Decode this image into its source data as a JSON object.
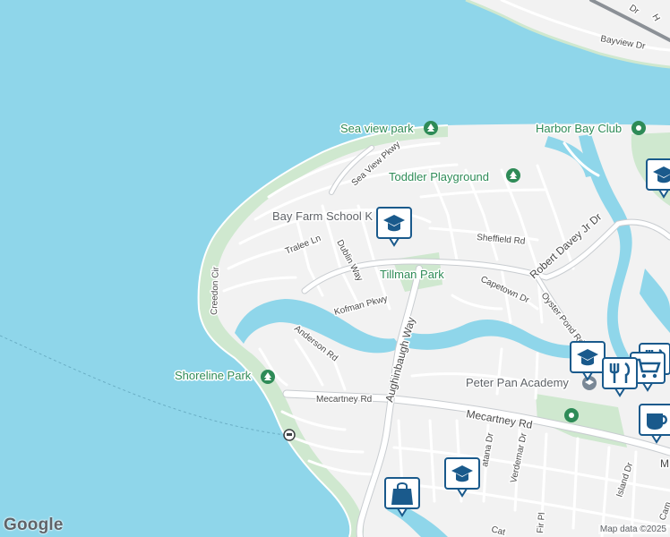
{
  "map": {
    "colors": {
      "water": "#8fd6ea",
      "land": "#f2f2f2",
      "park": "#cfe8cf",
      "road": "#ffffff",
      "road_outline": "#c8ccd0",
      "poi_green": "#2e8b57",
      "pin_blue": "#1a5a8c"
    },
    "parks": [
      {
        "name": "Sea view park",
        "icon": "tree-icon"
      },
      {
        "name": "Harbor Bay Club",
        "icon": "location-pin-icon"
      },
      {
        "name": "Toddler Playground",
        "icon": "tree-icon"
      },
      {
        "name": "Tillman Park",
        "icon": ""
      },
      {
        "name": "Shoreline Park",
        "icon": "tree-icon"
      },
      {
        "name": "Peter Pan Academy",
        "icon": "location-pin-icon"
      }
    ],
    "labels": {
      "bay_farm_school": "Bay Farm School K",
      "bayview_dr": "Bayview Dr",
      "top_dr": "Dr",
      "top_h": "H"
    },
    "streets": [
      "Sea View Pkwy",
      "Tralee Ln",
      "Dublin Way",
      "Creedon Cir",
      "Kofman Pkwy",
      "Anderson Rd",
      "Aughinbaugh Way",
      "Sheffield Rd",
      "Robert Davey Jr Dr",
      "Capetown Dr",
      "Oyster Pond Rd",
      "Mecartney Rd",
      "Mecartney Rd",
      "Verdemar Dr",
      "Island Dr",
      "atana Dr",
      "Fir Pl",
      "Cat"
    ],
    "edge_labels": {
      "right_m": "M",
      "bottom_right": "Cam"
    },
    "markers": [
      {
        "type": "school",
        "icon": "school-icon"
      },
      {
        "type": "school",
        "icon": "school-icon"
      },
      {
        "type": "school",
        "icon": "school-icon"
      },
      {
        "type": "school",
        "icon": "school-icon"
      },
      {
        "type": "restaurant",
        "icon": "restaurant-icon"
      },
      {
        "type": "grocery",
        "icon": "shopping-cart-icon"
      },
      {
        "type": "restaurant",
        "icon": "restaurant-icon"
      },
      {
        "type": "cafe",
        "icon": "coffee-cup-icon"
      },
      {
        "type": "shopping",
        "icon": "shopping-bag-icon"
      },
      {
        "type": "ferry",
        "icon": "ferry-icon"
      }
    ]
  },
  "footer": {
    "logo": "Google",
    "attribution": "Map data ©2025"
  }
}
